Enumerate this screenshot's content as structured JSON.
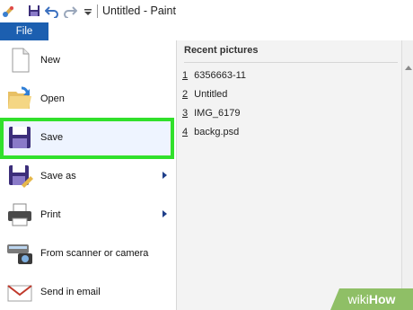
{
  "window": {
    "title": "Untitled - Paint"
  },
  "quick_access": {
    "icons": [
      "paint-app-icon",
      "save-icon",
      "undo-icon",
      "redo-icon",
      "customize-dropdown-icon"
    ]
  },
  "ribbon": {
    "file_tab": "File"
  },
  "file_menu": {
    "items": [
      {
        "label": "New",
        "icon": "new-document-icon",
        "has_submenu": false
      },
      {
        "label": "Open",
        "icon": "open-folder-icon",
        "has_submenu": false,
        "highlighted": true
      },
      {
        "label": "Save",
        "icon": "save-icon",
        "has_submenu": false
      },
      {
        "label": "Save as",
        "icon": "save-as-icon",
        "has_submenu": true
      },
      {
        "label": "Print",
        "icon": "printer-icon",
        "has_submenu": true
      },
      {
        "label": "From scanner or camera",
        "icon": "scanner-camera-icon",
        "has_submenu": false
      },
      {
        "label": "Send in email",
        "icon": "email-icon",
        "has_submenu": false
      }
    ]
  },
  "recent": {
    "header": "Recent pictures",
    "items": [
      {
        "num": "1",
        "name": "6356663-11"
      },
      {
        "num": "2",
        "name": "Untitled"
      },
      {
        "num": "3",
        "name": "IMG_6179"
      },
      {
        "num": "4",
        "name": "backg.psd"
      }
    ]
  },
  "watermark": {
    "prefix": "wiki",
    "suffix": "How"
  },
  "colors": {
    "file_tab": "#1c5fb0",
    "highlight_border": "#31e02b",
    "watermark_bg": "#8fbf66"
  }
}
